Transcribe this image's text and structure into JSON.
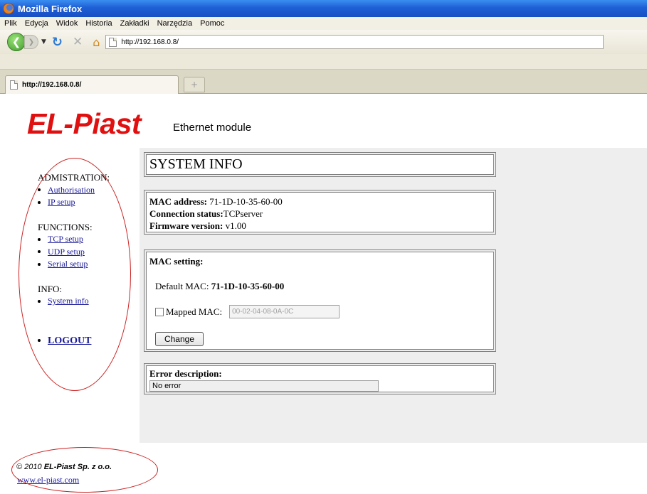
{
  "window": {
    "title": "Mozilla Firefox"
  },
  "menu": [
    "Plik",
    "Edycja",
    "Widok",
    "Historia",
    "Zakładki",
    "Narzędzia",
    "Pomoc"
  ],
  "nav": {
    "url": "http://192.168.0.8/"
  },
  "tabs": [
    {
      "label": "http://192.168.0.8/"
    }
  ],
  "page": {
    "logo": "EL-Piast",
    "logo_sub": "Ethernet module",
    "sidebar": {
      "admin_heading": "ADMISTRATION:",
      "admin_items": [
        "Authorisation",
        "IP setup"
      ],
      "functions_heading": "FUNCTIONS:",
      "functions_items": [
        "TCP setup",
        "UDP setup",
        "Serial setup"
      ],
      "info_heading": "INFO:",
      "info_items": [
        "System info"
      ],
      "logout": "LOGOUT"
    },
    "system_info_title": "SYSTEM INFO",
    "info": {
      "mac_label": "MAC address:",
      "mac_value": " 71-1D-10-35-60-00",
      "conn_label": "Connection status:",
      "conn_value": "TCPserver",
      "fw_label": "Firmware version:",
      "fw_value": " v1.00"
    },
    "mac_setting": {
      "title": "MAC setting:",
      "default_label": "Default MAC: ",
      "default_value": "71-1D-10-35-60-00",
      "mapped_label": "Mapped MAC:",
      "mapped_value": "00-02-04-08-0A-0C",
      "mapped_checked": false,
      "change_button": "Change"
    },
    "error": {
      "title": "Error description:",
      "value": "No error"
    },
    "footer": {
      "copyright_prefix": "© 2010 ",
      "company": "EL-Piast Sp. z o.o.",
      "link": "www.el-piast.com"
    }
  }
}
